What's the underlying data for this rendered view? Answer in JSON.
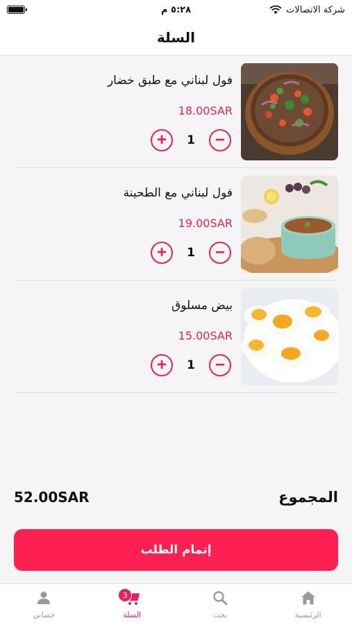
{
  "status_bar": {
    "carrier": "شركة الاتصالات",
    "time": "٥:٢٨ م"
  },
  "header": {
    "title": "السلة"
  },
  "currency": "SAR",
  "items": [
    {
      "name": "فول لبناني مع طبق خضار",
      "price": "18.00SAR",
      "quantity": "1",
      "image": "bowl-of-foul-with-salad"
    },
    {
      "name": "فول لبناني مع الطحينة",
      "price": "19.00SAR",
      "quantity": "1",
      "image": "bowl-of-foul-with-tahini"
    },
    {
      "name": "بيض مسلوق",
      "price": "15.00SAR",
      "quantity": "1",
      "image": "boiled-eggs-plate"
    }
  ],
  "total": {
    "label": "المجموع",
    "amount": "52.00SAR"
  },
  "checkout": {
    "label": "إتمام الطلب"
  },
  "bottom_nav": {
    "items": [
      {
        "label": "حسابي",
        "icon": "person-icon"
      },
      {
        "label": "السلة",
        "icon": "cart-icon",
        "badge": "3",
        "active": true
      },
      {
        "label": "بحث",
        "icon": "search-icon"
      },
      {
        "label": "الرئيسية",
        "icon": "home-icon"
      }
    ]
  },
  "colors": {
    "accent": "#e8205a",
    "checkout": "#ff1f51",
    "background": "#f5f5f5"
  }
}
